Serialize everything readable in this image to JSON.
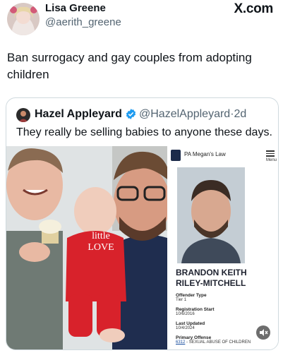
{
  "post": {
    "author_name": "Lisa Greene",
    "author_handle": "@aerith_greene",
    "brand": "X.com",
    "text": "Ban surrogacy and gay couples from adopting children"
  },
  "quote": {
    "author_name": "Hazel Appleyard",
    "author_handle": "@HazelAppleyard",
    "separator": "·",
    "time": "2d",
    "text": "They really be selling babies to anyone these days.",
    "photo": {
      "onesie_text_line1": "little",
      "onesie_text_line2": "LOVE"
    },
    "document": {
      "site": "PA Megan's Law",
      "menu_label": "Menu",
      "offender_name": "BRANDON KEITH RILEY-MITCHELL",
      "fields": [
        {
          "label": "Offender Type",
          "value": "Tier 1"
        },
        {
          "label": "Registration Start",
          "value": "10/6/2016"
        },
        {
          "label": "Last Updated",
          "value": "10/4/2024"
        }
      ],
      "primary_offense_label": "Primary Offense",
      "offense_code": "6312",
      "offense_text": " - SEXUAL ABUSE OF CHILDREN"
    }
  },
  "colors": {
    "verified": "#1d9bf0",
    "muted_text": "#536471",
    "onesie": "#d8222b"
  },
  "icons": {
    "verified": "verified-badge-icon",
    "mute": "mute-icon",
    "menu": "hamburger-menu-icon"
  }
}
